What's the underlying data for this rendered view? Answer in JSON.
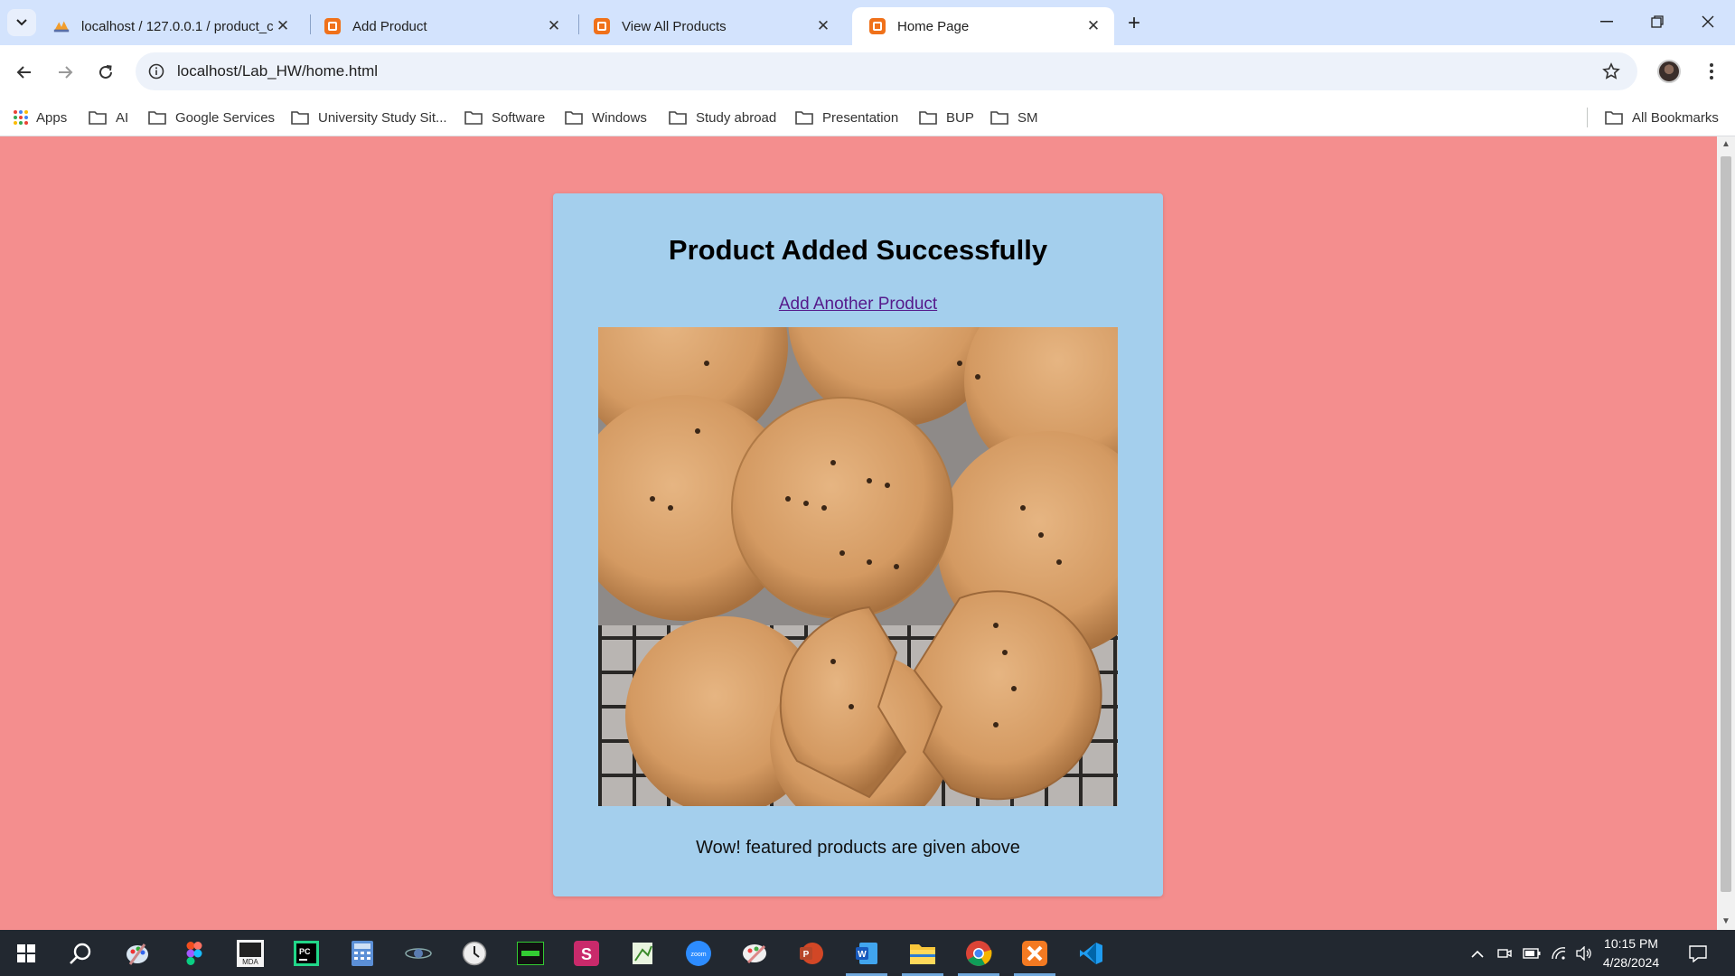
{
  "browser": {
    "tabs": [
      {
        "title": "localhost / 127.0.0.1 / product_c",
        "icon": "phpmyadmin-icon",
        "active": false
      },
      {
        "title": "Add Product",
        "icon": "xampp-icon",
        "active": false
      },
      {
        "title": "View All Products",
        "icon": "xampp-icon",
        "active": false
      },
      {
        "title": "Home Page",
        "icon": "xampp-icon",
        "active": true
      }
    ],
    "url": "localhost/Lab_HW/home.html",
    "bookmarks": [
      "Apps",
      "AI",
      "Google Services",
      "University Study Sit...",
      "Software",
      "Windows",
      "Study abroad",
      "Presentation",
      "BUP",
      "SM"
    ],
    "all_bookmarks": "All Bookmarks"
  },
  "page": {
    "heading": "Product Added Successfully",
    "link": "Add Another Product",
    "image_subject": "cookies",
    "caption": "Wow! featured products are given above",
    "background_color": "#f48e8e",
    "card_color": "#a4cfed"
  },
  "taskbar": {
    "apps": [
      "start-icon",
      "search-icon",
      "paint-icon",
      "figma-icon",
      "mdb-icon",
      "pycharm-icon",
      "calculator-icon",
      "satellite-icon",
      "clock-icon",
      "terminal-icon",
      "slides-icon",
      "notepad-icon",
      "zoom-icon",
      "paint-3d-icon",
      "powerpoint-icon",
      "word-icon",
      "file-explorer-icon",
      "chrome-icon",
      "xampp-icon",
      "vscode-icon"
    ],
    "time": "10:15 PM",
    "date": "4/28/2024"
  }
}
